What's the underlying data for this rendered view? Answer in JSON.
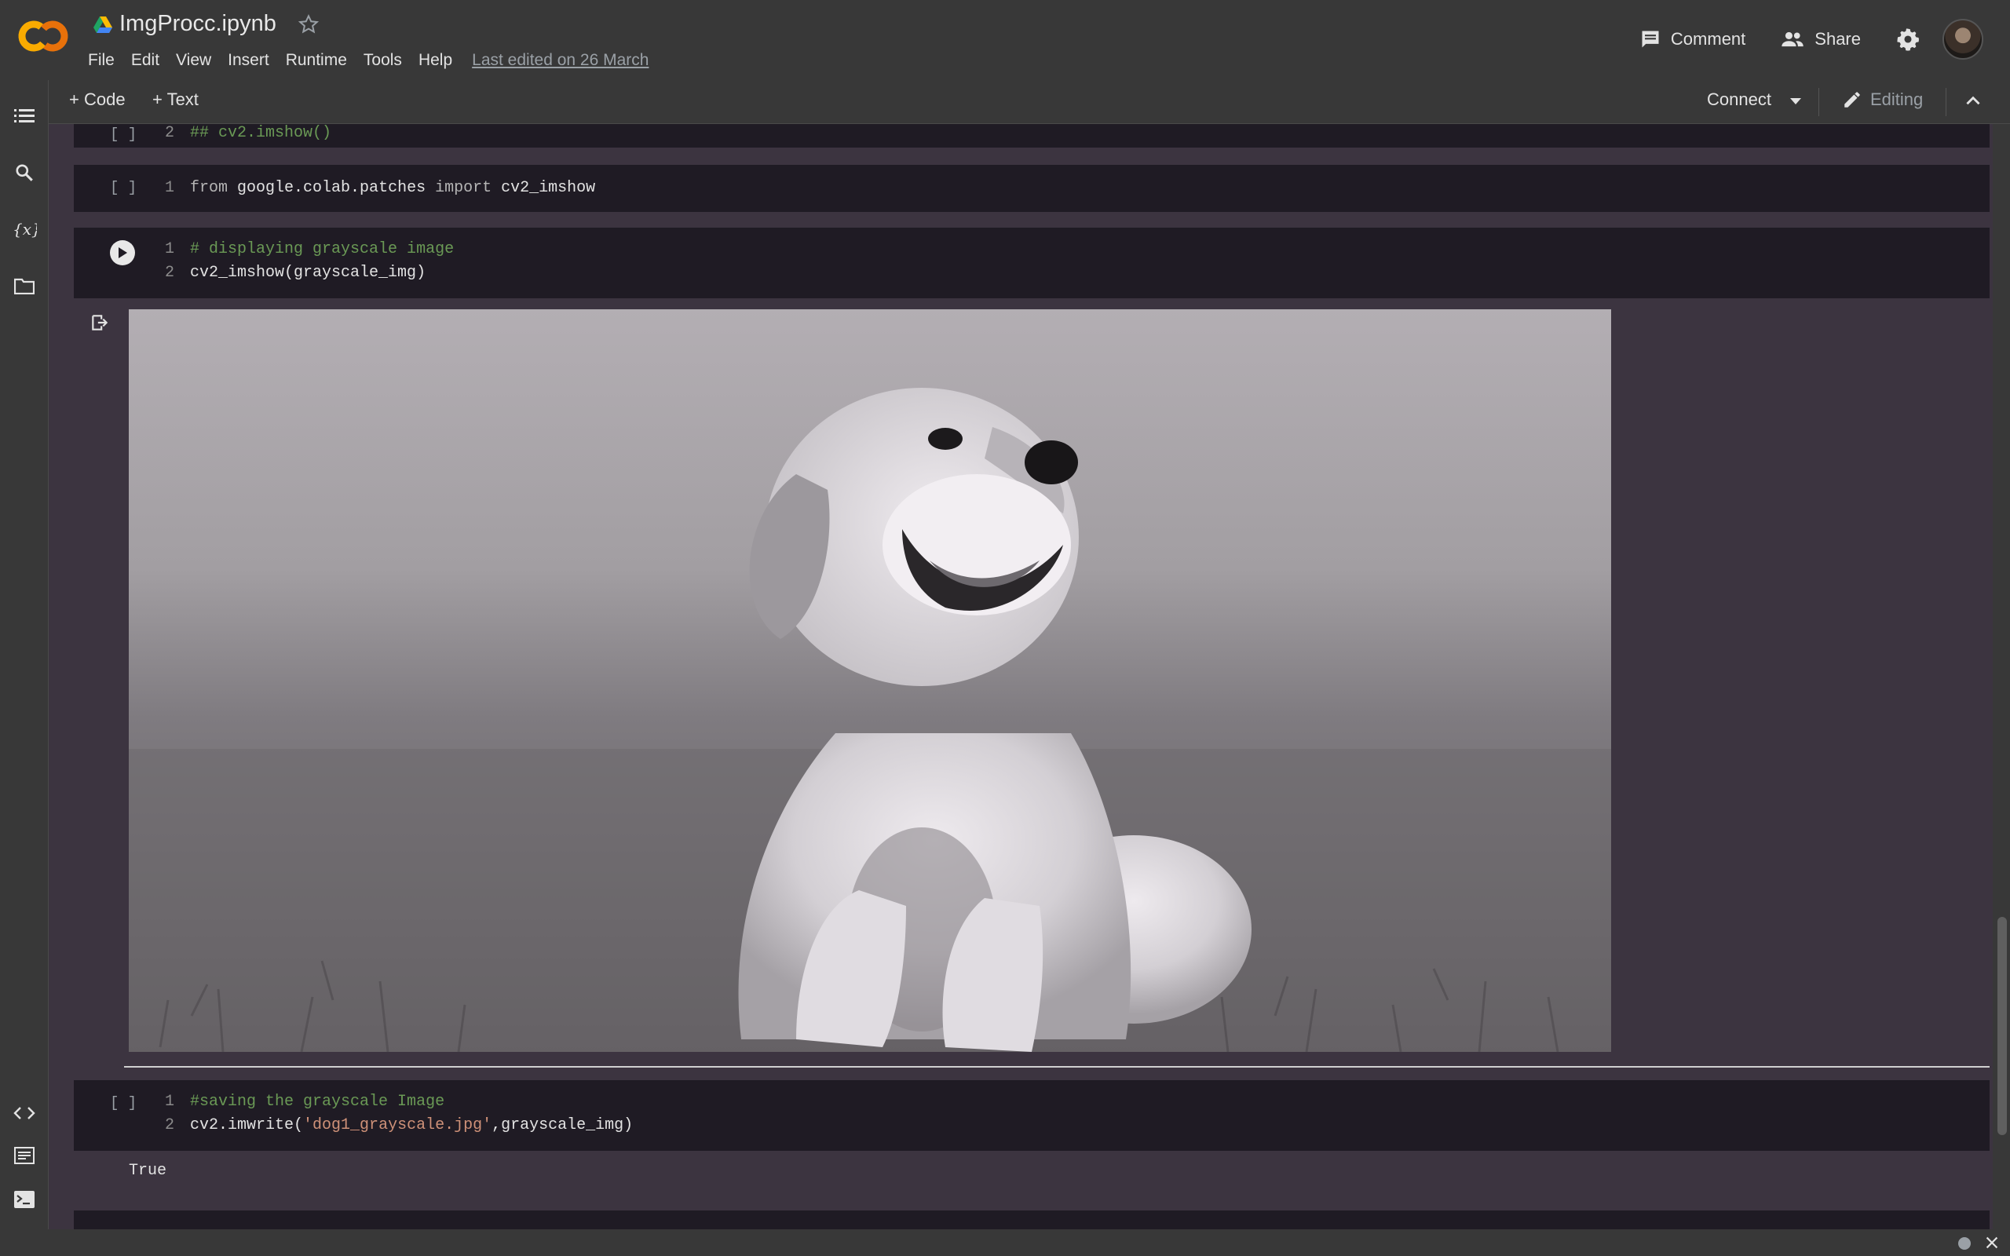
{
  "app": {
    "logo_text": "CO",
    "title": "ImgProcc.ipynb",
    "menu": [
      "File",
      "Edit",
      "View",
      "Insert",
      "Runtime",
      "Tools",
      "Help"
    ],
    "last_edited": "Last edited on 26 March",
    "comment_label": "Comment",
    "share_label": "Share"
  },
  "toolbar": {
    "add_code": "+ Code",
    "add_text": "+ Text",
    "connect": "Connect",
    "editing": "Editing"
  },
  "cells": {
    "cell0": {
      "bracket": "[ ]",
      "line2_num": "2",
      "line2": "## cv2.imshow()"
    },
    "cell1": {
      "bracket": "[ ]",
      "num": "1",
      "kw1": "from",
      "mod": " google.colab.patches ",
      "kw2": "import",
      "rest": " cv2_imshow"
    },
    "cell2": {
      "line1_num": "1",
      "line1": "# displaying grayscale image",
      "line2_num": "2",
      "line2": "cv2_imshow(grayscale_img)"
    },
    "cell3": {
      "bracket": "[ ]",
      "line1_num": "1",
      "line1": "#saving the grayscale Image",
      "line2_num": "2",
      "line2_a": "cv2.imwrite(",
      "line2_str": "'dog1_grayscale.jpg'",
      "line2_b": ",grayscale_img)",
      "output": "True"
    }
  },
  "icons": {
    "rail": [
      "toc-icon",
      "search-icon",
      "variables-icon",
      "folder-icon",
      "code-snippets-icon",
      "command-palette-icon",
      "terminal-icon"
    ]
  },
  "colors": {
    "logo_orange": "#f9ab00",
    "background": "#383838",
    "cell_bg": "#1f1b24",
    "notebook_bg": "#3c3440",
    "comment_green": "#6a9955",
    "string_orange": "#ce9178"
  }
}
